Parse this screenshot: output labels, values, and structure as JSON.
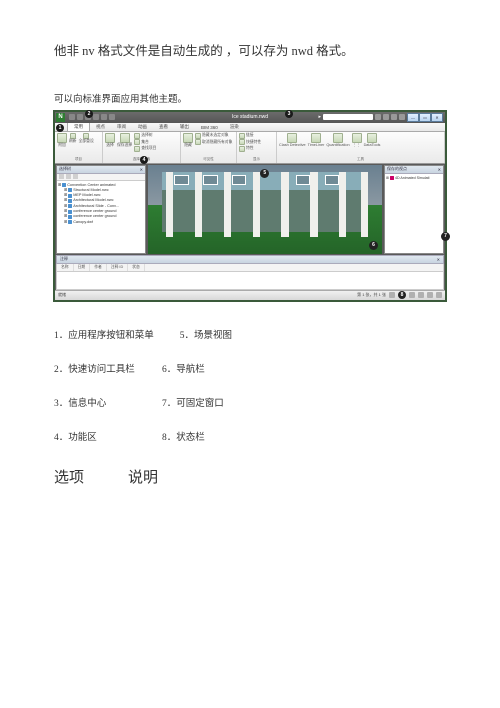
{
  "heading": "他非 nv 格式文件是自动生成的 ，可以存为 nwd 格式。",
  "subnote": "可以向标准界面应用其他主题。",
  "app": {
    "title_filename": "Ice stadium.nwd",
    "search_placeholder": "...",
    "tabs": [
      "常用",
      "视点",
      "审阅",
      "动画",
      "查看",
      "输出",
      "BIM 360",
      "渲染"
    ],
    "ribbon_groups": [
      {
        "label": "项目",
        "buttons": [
          "附加",
          "刷新",
          "全部重设"
        ]
      },
      {
        "label": "选择和搜索",
        "buttons": [
          "选择",
          "保存选择",
          "选择相同对象",
          "选择树",
          "集合",
          "查找项目"
        ]
      },
      {
        "label": "可见性",
        "buttons": [
          "隐藏",
          "强制可见",
          "隐藏未选定对象",
          "取消隐藏所有对象"
        ]
      },
      {
        "label": "显示",
        "buttons": [
          "链接",
          "快捷特性",
          "特性"
        ]
      },
      {
        "label": "工具",
        "buttons": [
          "Clash Detective",
          "TimeLiner",
          "Quantification",
          "",
          "DataTools"
        ]
      }
    ],
    "left_panel": {
      "title": "选择树",
      "items": [
        "Convention Center animated",
        "Structural Model.nwc",
        "MEP Model.nwc",
        "Architectural Model.nwc",
        "Architectural Slide - Conv...",
        "conference center ground",
        "conference center ground",
        "Canopy.dwf"
      ]
    },
    "right_panel": {
      "title": "保存的视点",
      "item": "4D Animated Simulati"
    },
    "comments": {
      "title": "注释",
      "cols": [
        "名称",
        "日期",
        "作者",
        "注释 ID",
        "状态"
      ]
    },
    "status": {
      "left": "就绪",
      "right": "第 1 张，共 1 张"
    }
  },
  "legend": [
    [
      "1．应用程序按钮和菜单",
      "5．场景视图"
    ],
    [
      "2．快速访问工具栏",
      "6．导航栏"
    ],
    [
      "3．信息中心",
      "7．可固定窗口"
    ],
    [
      "4．功能区",
      "8．状态栏"
    ]
  ],
  "section": {
    "opt": "选项",
    "desc": "说明"
  }
}
